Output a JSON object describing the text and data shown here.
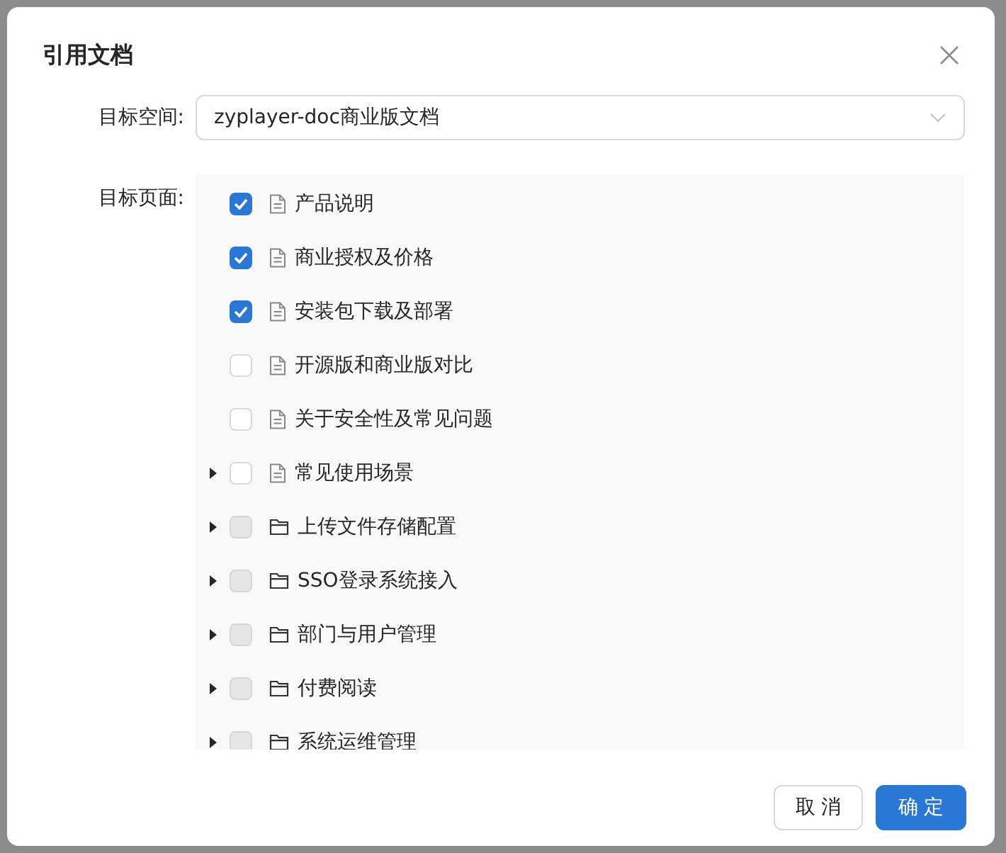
{
  "dialog": {
    "title": "引用文档"
  },
  "space_field": {
    "label": "目标空间:",
    "value": "zyplayer-doc商业版文档"
  },
  "pages": {
    "label": "目标页面:",
    "items": [
      {
        "kind": "doc",
        "title": "产品说明",
        "checked": true,
        "disabled": false,
        "expandable": false
      },
      {
        "kind": "doc",
        "title": "商业授权及价格",
        "checked": true,
        "disabled": false,
        "expandable": false
      },
      {
        "kind": "doc",
        "title": "安装包下载及部署",
        "checked": true,
        "disabled": false,
        "expandable": false
      },
      {
        "kind": "doc",
        "title": "开源版和商业版对比",
        "checked": false,
        "disabled": false,
        "expandable": false
      },
      {
        "kind": "doc",
        "title": "关于安全性及常见问题",
        "checked": false,
        "disabled": false,
        "expandable": false
      },
      {
        "kind": "doc",
        "title": "常见使用场景",
        "checked": false,
        "disabled": false,
        "expandable": true
      },
      {
        "kind": "folder",
        "title": "上传文件存储配置",
        "checked": false,
        "disabled": true,
        "expandable": true
      },
      {
        "kind": "folder",
        "title": "SSO登录系统接入",
        "checked": false,
        "disabled": true,
        "expandable": true
      },
      {
        "kind": "folder",
        "title": "部门与用户管理",
        "checked": false,
        "disabled": true,
        "expandable": true
      },
      {
        "kind": "folder",
        "title": "付费阅读",
        "checked": false,
        "disabled": true,
        "expandable": true
      },
      {
        "kind": "folder",
        "title": "系统运维管理",
        "checked": false,
        "disabled": true,
        "expandable": true
      }
    ]
  },
  "buttons": [
    {
      "kind": "default",
      "label": "取 消"
    },
    {
      "kind": "primary",
      "label": "确 定"
    }
  ]
}
